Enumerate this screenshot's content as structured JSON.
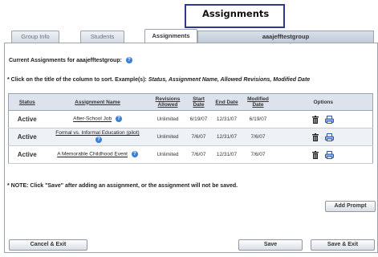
{
  "callout": {
    "title": "Assignments"
  },
  "tabs": [
    {
      "label": "Group Info"
    },
    {
      "label": "Students"
    },
    {
      "label": "Assignments"
    }
  ],
  "group_name": "aaajefftestgroup",
  "current_label": "Current Assignments for aaajefftestgroup:",
  "hint": {
    "prefix": "* Click on the title of the column to sort. Example(s):",
    "examples": "Status, Assignment Name, Allowed Revisions, Modified Date"
  },
  "table": {
    "headers": {
      "status": "Status",
      "name": "Assignment Name",
      "revisions": "Revisions Allowed",
      "start": "Start Date",
      "end": "End Date",
      "modified": "Modified Date",
      "options": "Options"
    },
    "rows": [
      {
        "status": "Active",
        "name": "After-School Job",
        "revisions": "Unlimited",
        "start": "6/19/07",
        "end": "12/31/07",
        "modified": "6/19/07"
      },
      {
        "status": "Active",
        "name": "Formal vs. Informal Education (pilot)",
        "revisions": "Unlimited",
        "start": "7/6/07",
        "end": "12/31/07",
        "modified": "7/6/07"
      },
      {
        "status": "Active",
        "name": "A Memorable Childhood Event",
        "revisions": "Unlimited",
        "start": "7/6/07",
        "end": "12/31/07",
        "modified": "7/6/07"
      }
    ]
  },
  "note": "* NOTE: Click \"Save\" after adding an assignment, or the assignment will not be saved.",
  "buttons": {
    "add_prompt": "Add Prompt",
    "cancel_exit": "Cancel & Exit",
    "save": "Save",
    "save_exit": "Save & Exit"
  },
  "colors": {
    "accent": "#2d3a8c",
    "active_status": "#2f8a2f",
    "header_bg": "#dde3ec",
    "info_icon": "#3c7fd6"
  }
}
